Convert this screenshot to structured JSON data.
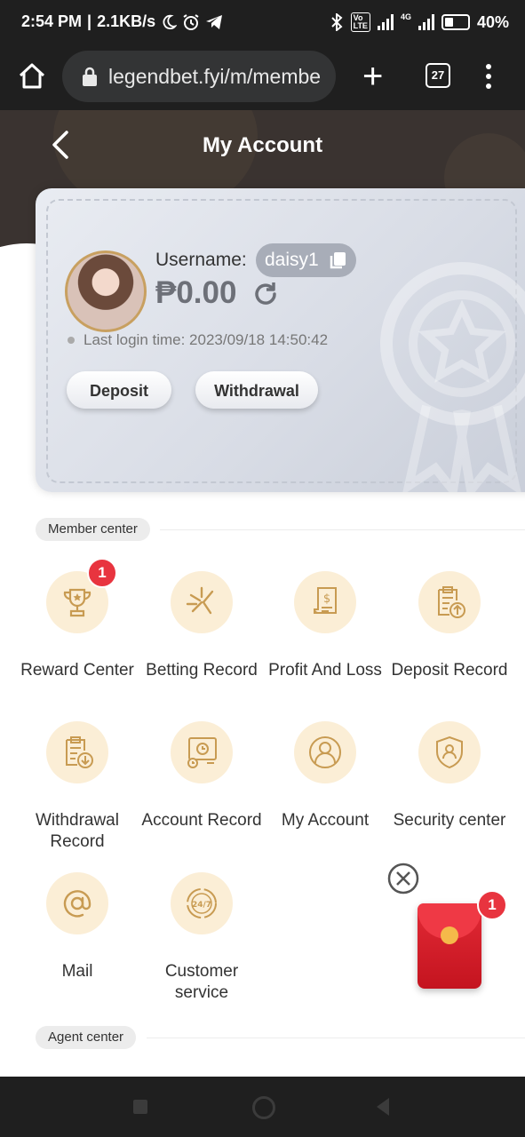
{
  "status_bar": {
    "time": "2:54 PM",
    "speed": "2.1KB/s",
    "network": "4G",
    "battery": "40%"
  },
  "browser": {
    "url": "legendbet.fyi/m/membe",
    "tab_count": "27"
  },
  "header": {
    "title": "My Account"
  },
  "card": {
    "username_label": "Username:",
    "username": "daisy1",
    "balance": "₱0.00",
    "last_login": "Last login time: 2023/09/18 14:50:42",
    "deposit_label": "Deposit",
    "withdrawal_label": "Withdrawal"
  },
  "member_center": {
    "title": "Member center",
    "items": [
      {
        "label": "Reward Center",
        "badge": "1",
        "icon": "trophy-icon"
      },
      {
        "label": "Betting Record",
        "icon": "betting-icon"
      },
      {
        "label": "Profit And Loss",
        "icon": "receipt-icon"
      },
      {
        "label": "Deposit Record",
        "icon": "clipboard-upload-icon"
      },
      {
        "label": "Withdrawal Record",
        "icon": "clipboard-download-icon"
      },
      {
        "label": "Account Record",
        "icon": "monitor-clock-icon"
      },
      {
        "label": "My Account",
        "icon": "user-icon"
      },
      {
        "label": "Security center",
        "icon": "shield-user-icon"
      },
      {
        "label": "Mail",
        "icon": "at-icon"
      },
      {
        "label": "Customer service",
        "icon": "support-247-icon"
      }
    ]
  },
  "agent_center": {
    "title": "Agent center"
  },
  "floating": {
    "badge": "1"
  },
  "colors": {
    "accent_bg": "#fbeed6",
    "accent": "#c89b52",
    "badge": "#e8343f"
  }
}
